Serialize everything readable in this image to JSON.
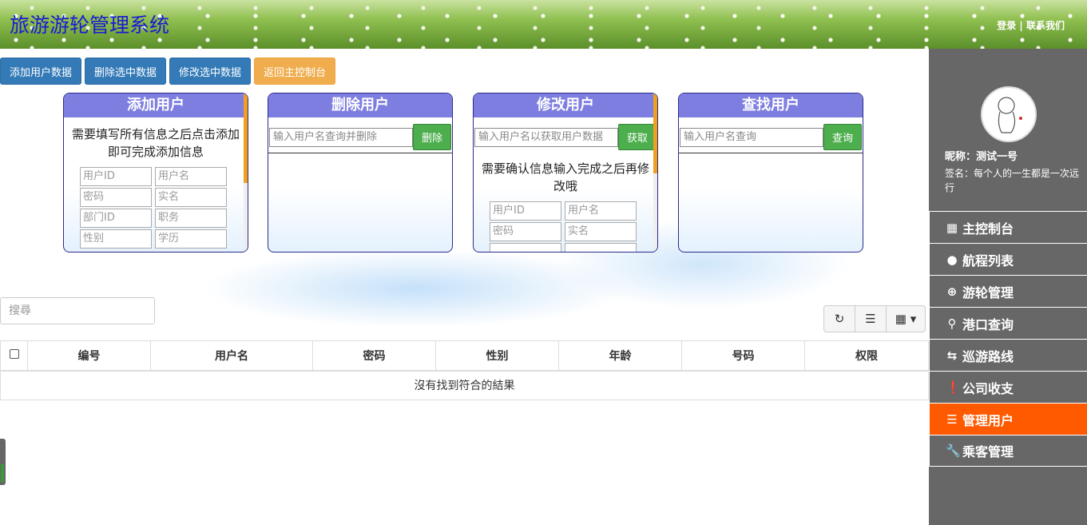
{
  "header": {
    "title": "旅游游轮管理系统",
    "login": "登录",
    "separator": "|",
    "contact": "联系我们"
  },
  "toolbar": {
    "add": "添加用户数据",
    "delete": "删除选中数据",
    "edit": "修改选中数据",
    "back": "返回主控制台"
  },
  "panels": {
    "add": {
      "title": "添加用户",
      "desc": "需要填写所有信息之后点击添加即可完成添加信息",
      "fields": [
        "用户ID",
        "用户名",
        "密码",
        "实名",
        "部门ID",
        "职务",
        "性别",
        "学历"
      ]
    },
    "delete": {
      "title": "删除用户",
      "placeholder": "输入用户名查询并删除",
      "button": "删除"
    },
    "modify": {
      "title": "修改用户",
      "placeholder": "输入用户名以获取用户数据",
      "button": "获取",
      "desc": "需要确认信息输入完成之后再修改哦",
      "fields": [
        "用户ID",
        "用户名",
        "密码",
        "实名"
      ]
    },
    "find": {
      "title": "查找用户",
      "placeholder": "输入用户名查询",
      "button": "查询"
    }
  },
  "search": {
    "placeholder": "搜尋"
  },
  "table": {
    "columns": [
      "编号",
      "用户名",
      "密码",
      "性别",
      "年龄",
      "号码",
      "权限"
    ],
    "empty": "沒有找到符合的結果"
  },
  "sidebar": {
    "nickname": "昵称：测试一号",
    "signature": "签名：每个人的一生都是一次远行",
    "menu": [
      {
        "label": "主控制台",
        "icon": "dashboard-icon"
      },
      {
        "label": "航程列表",
        "icon": "user-icon"
      },
      {
        "label": "游轮管理",
        "icon": "plus-circle-icon"
      },
      {
        "label": "港口查询",
        "icon": "search-icon"
      },
      {
        "label": "巡游路线",
        "icon": "retweet-icon"
      },
      {
        "label": "公司收支",
        "icon": "exclamation-icon"
      },
      {
        "label": "管理用户",
        "icon": "list-icon",
        "active": true
      },
      {
        "label": "乘客管理",
        "icon": "wrench-icon"
      }
    ]
  },
  "colors": {
    "accent": "#ff5a00",
    "primary": "#337ab7",
    "panel_header": "#7e7ee0",
    "sidebar": "#676767"
  }
}
